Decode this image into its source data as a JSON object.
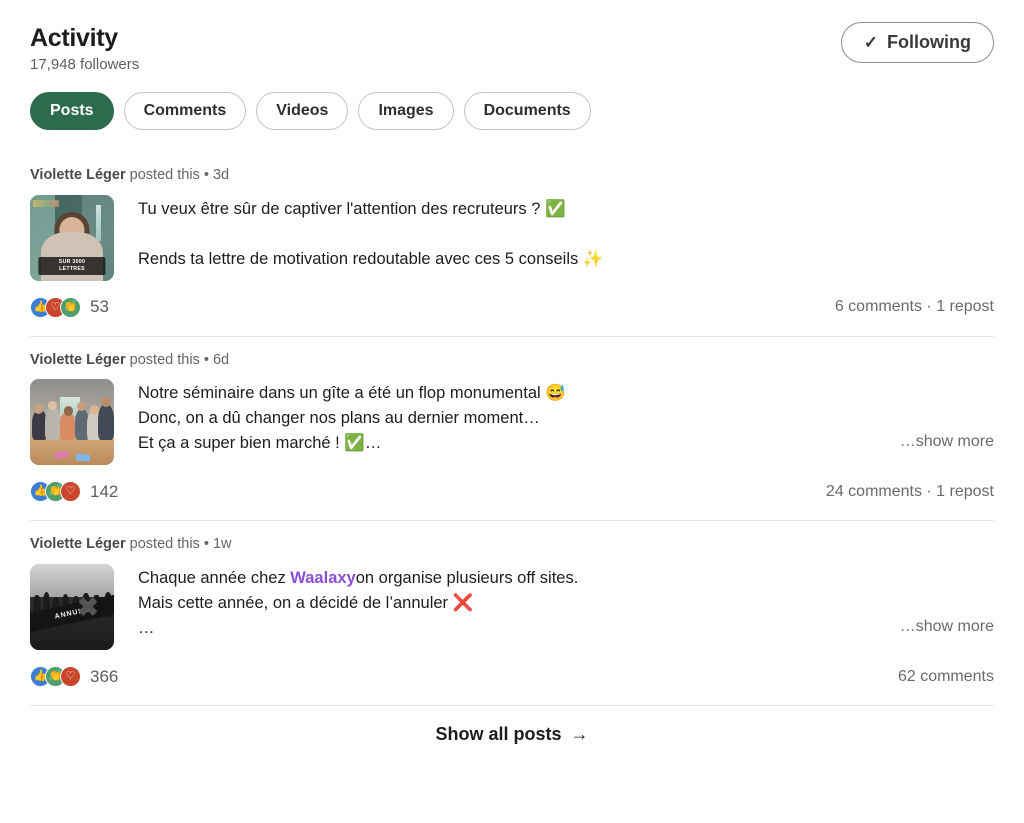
{
  "header": {
    "title": "Activity",
    "followers": "17,948 followers",
    "follow_button": {
      "label": "Following",
      "check_icon": "check-icon",
      "check_glyph": "✓"
    }
  },
  "filters": {
    "active": "Posts",
    "items": [
      {
        "label": "Posts",
        "active": true
      },
      {
        "label": "Comments",
        "active": false
      },
      {
        "label": "Videos",
        "active": false
      },
      {
        "label": "Images",
        "active": false
      },
      {
        "label": "Documents",
        "active": false
      }
    ]
  },
  "posts": [
    {
      "author": "Violette Léger",
      "action": "posted this",
      "separator": "•",
      "time": "3d",
      "thumbnail": {
        "name": "post-thumbnail-video",
        "caption_line1": "SUR 3000",
        "caption_line2": "LETTRES",
        "alt": "woman seated at a desk, teal background"
      },
      "lines": [
        "Tu veux être sûr de captiver l'attention des recruteurs ? ✅",
        "",
        "Rends ta lettre de motivation redoutable avec ces 5 conseils ✨"
      ],
      "show_more": "",
      "reactions": {
        "icons": [
          "like",
          "love",
          "celebrate"
        ],
        "count": "53"
      },
      "engagement": "6 comments · 1 repost"
    },
    {
      "author": "Violette Léger",
      "action": "posted this",
      "separator": "•",
      "time": "6d",
      "thumbnail": {
        "name": "post-thumbnail-group",
        "caption_line1": "",
        "caption_line2": "",
        "alt": "group of people around a wooden table"
      },
      "lines": [
        "Notre séminaire dans un gîte a été un flop monumental 😅",
        "Donc, on a dû changer nos plans au dernier moment…",
        "Et ça a super bien marché ! ✅…"
      ],
      "show_more": "…show more",
      "reactions": {
        "icons": [
          "like",
          "celebrate",
          "love"
        ],
        "count": "142"
      },
      "engagement": "24 comments · 1 repost"
    },
    {
      "author": "Violette Léger",
      "action": "posted this",
      "separator": "•",
      "time": "1w",
      "thumbnail": {
        "name": "post-thumbnail-cancelled",
        "caption_line1": "ANNULÉ",
        "caption_line2": "",
        "alt": "black and white crowd with ANNULÉ banner and red cross"
      },
      "lines": [
        "Chaque année chez ",
        "Mais cette année, on a décidé de l’annuler ❌",
        "…"
      ],
      "mention": "Waalaxy",
      "line1_after_mention": "on organise plusieurs off sites.",
      "show_more": "…show more",
      "reactions": {
        "icons": [
          "like",
          "celebrate",
          "love"
        ],
        "count": "366"
      },
      "engagement": "62 comments"
    }
  ],
  "footer": {
    "show_all_label": "Show all posts",
    "arrow_icon": "arrow-right-icon",
    "arrow_glyph": "→"
  },
  "colors": {
    "accent_green": "#2d6b4f",
    "mention_purple": "#8b4fd6",
    "reaction_like": "#3b7fd4",
    "reaction_love": "#c9462c",
    "reaction_celebrate": "#4d9e6a"
  }
}
